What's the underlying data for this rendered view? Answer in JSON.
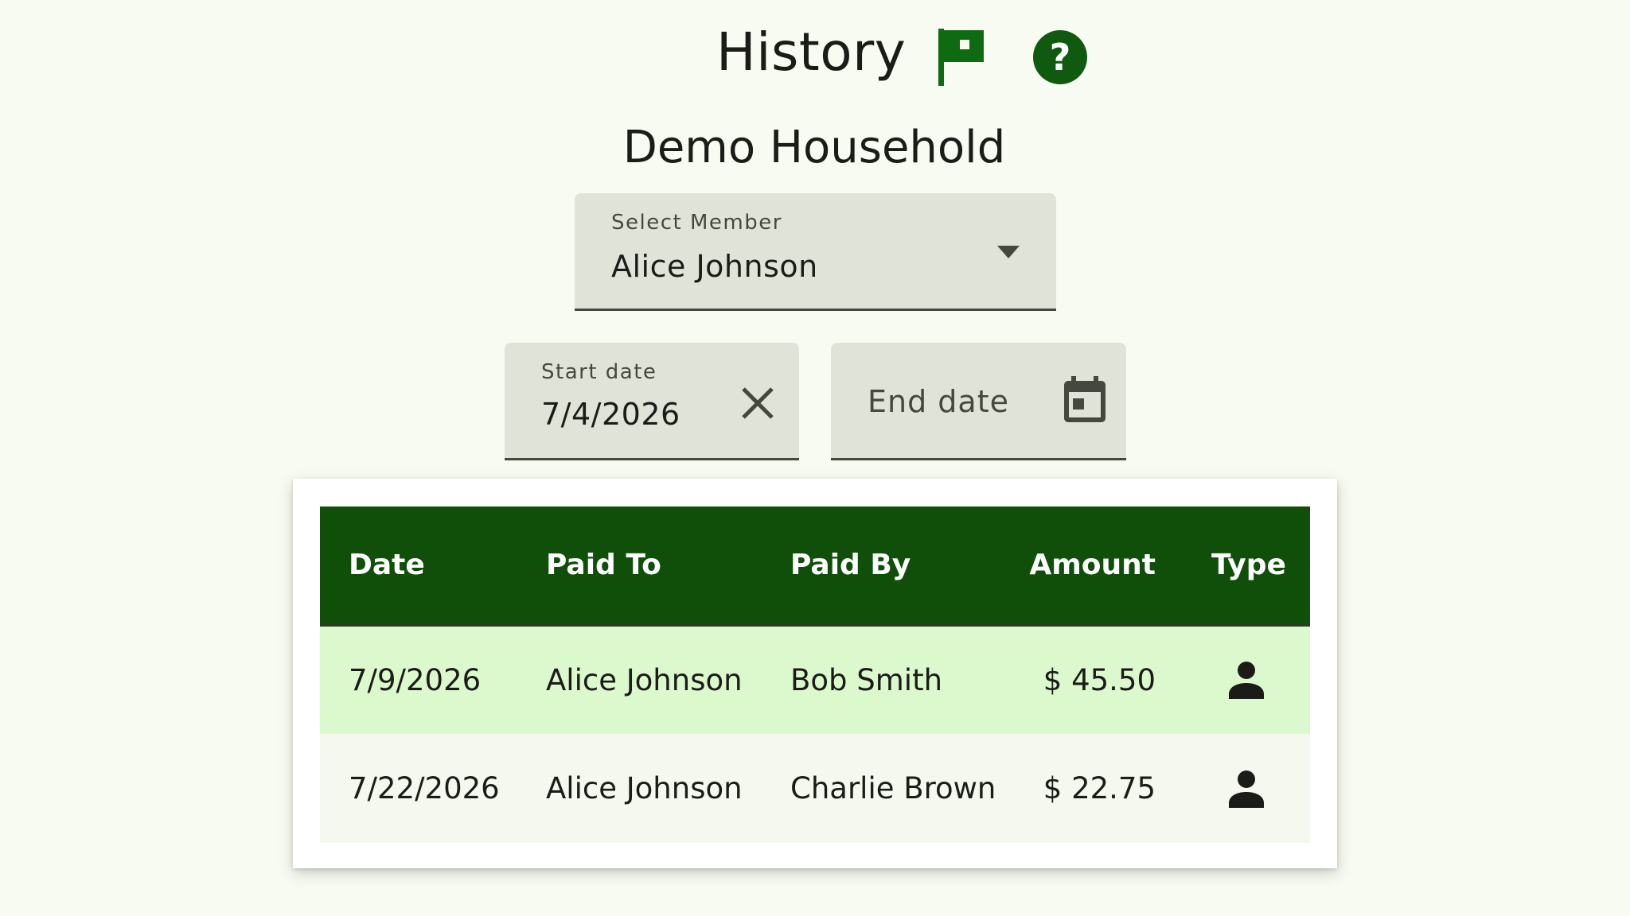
{
  "header": {
    "title": "History",
    "flag_icon": "flag-icon",
    "help_icon": "help-icon",
    "accent_color": "#0f4f0a"
  },
  "household": {
    "name": "Demo Household"
  },
  "member_select": {
    "label": "Select Member",
    "value": "Alice Johnson",
    "icon": "dropdown-arrow-icon"
  },
  "date_filters": {
    "start": {
      "label": "Start date",
      "value": "7/4/2026",
      "clear_icon": "close-icon"
    },
    "end": {
      "placeholder": "End date",
      "icon": "calendar-icon"
    }
  },
  "table": {
    "headers": [
      "Date",
      "Paid To",
      "Paid By",
      "Amount",
      "Type"
    ],
    "rows": [
      {
        "date": "7/9/2026",
        "paid_to": "Alice Johnson",
        "paid_by": "Bob Smith",
        "amount": "$ 45.50",
        "type_icon": "person-icon"
      },
      {
        "date": "7/22/2026",
        "paid_to": "Alice Johnson",
        "paid_by": "Charlie Brown",
        "amount": "$ 22.75",
        "type_icon": "person-icon"
      }
    ],
    "header_color": "#0f4f0a",
    "highlight_row_color": "#dcf8cd"
  }
}
